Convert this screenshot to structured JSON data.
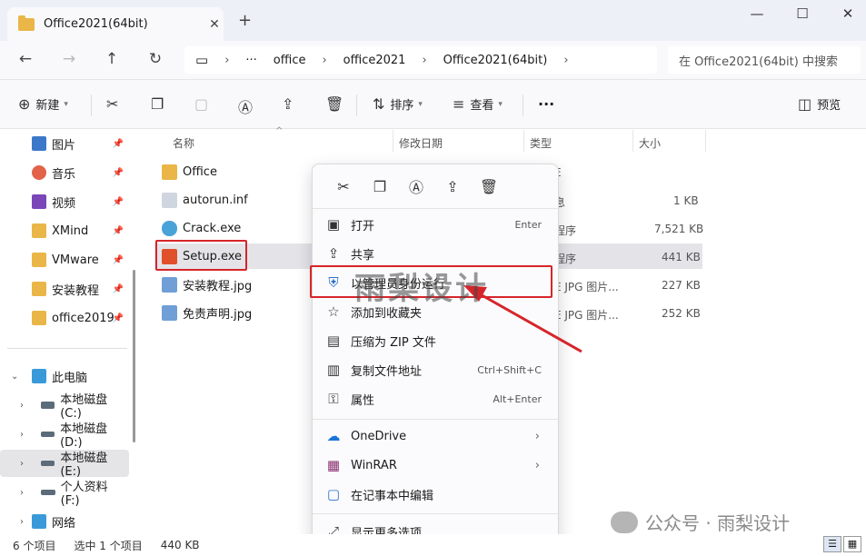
{
  "window": {
    "tab_title": "Office2021(64bit)",
    "new_tab": "+",
    "close_tab": "✕",
    "minimize": "—",
    "maximize": "☐",
    "close": "✕"
  },
  "address": {
    "crumbs": [
      "office",
      "office2021",
      "Office2021(64bit)"
    ],
    "more": "···",
    "search_placeholder": "在 Office2021(64bit) 中搜索"
  },
  "toolbar": {
    "new": "新建",
    "sort": "排序",
    "view": "查看",
    "more": "···",
    "preview": "预览"
  },
  "sidebar": {
    "quick": [
      {
        "label": "图片",
        "color": "#3b78c9"
      },
      {
        "label": "音乐",
        "color": "#e2624a"
      },
      {
        "label": "视频",
        "color": "#7a46b8"
      },
      {
        "label": "XMind",
        "color": "#e9b647"
      },
      {
        "label": "VMware",
        "color": "#e9b647"
      },
      {
        "label": "安装教程",
        "color": "#e9b647"
      },
      {
        "label": "office2019",
        "color": "#e9b647"
      }
    ],
    "pc": "此电脑",
    "drives": [
      "本地磁盘 (C:)",
      "本地磁盘 (D:)",
      "本地磁盘 (E:)",
      "个人资料 (F:)"
    ],
    "network": "网络"
  },
  "columns": {
    "name": "名称",
    "modified": "修改日期",
    "type": "类型",
    "size": "大小"
  },
  "files": [
    {
      "name": "Office",
      "type_frag": "",
      "size": "",
      "color": "#e9b647"
    },
    {
      "name": "autorun.inf",
      "type_frag": "息",
      "size": "1 KB",
      "color": "#cfd6e0"
    },
    {
      "name": "Crack.exe",
      "type_frag": "程序",
      "size": "7,521 KB",
      "color": "#4aa3d8"
    },
    {
      "name": "Setup.exe",
      "type_frag": "程序",
      "size": "441 KB",
      "color": "#e0502b"
    },
    {
      "name": "安装教程.jpg",
      "type_frag": "E JPG 图片...",
      "size": "227 KB",
      "color": "#6f9fd6"
    },
    {
      "name": "免责声明.jpg",
      "type_frag": "E JPG 图片...",
      "size": "252 KB",
      "color": "#6f9fd6"
    }
  ],
  "folder_type_frag": "E",
  "context_menu": {
    "items": [
      {
        "label": "打开",
        "shortcut": "Enter",
        "icon": "▣"
      },
      {
        "label": "共享",
        "shortcut": "",
        "icon": "⇪"
      },
      {
        "label": "以管理员身份运行",
        "shortcut": "",
        "icon": "⛨"
      },
      {
        "label": "添加到收藏夹",
        "shortcut": "",
        "icon": "☆"
      },
      {
        "label": "压缩为 ZIP 文件",
        "shortcut": "",
        "icon": "▤"
      },
      {
        "label": "复制文件地址",
        "shortcut": "Ctrl+Shift+C",
        "icon": "▥"
      },
      {
        "label": "属性",
        "shortcut": "Alt+Enter",
        "icon": "⚿"
      }
    ],
    "apps": [
      {
        "label": "OneDrive",
        "icon": "☁"
      },
      {
        "label": "WinRAR",
        "icon": "▦"
      },
      {
        "label": "在记事本中编辑",
        "icon": "▢"
      }
    ],
    "more": "显示更多选项"
  },
  "watermark": "雨梨设计",
  "wechat": "公众号 · 雨梨设计",
  "status": {
    "count": "6 个项目",
    "selected": "选中 1 个项目",
    "size": "440 KB"
  }
}
